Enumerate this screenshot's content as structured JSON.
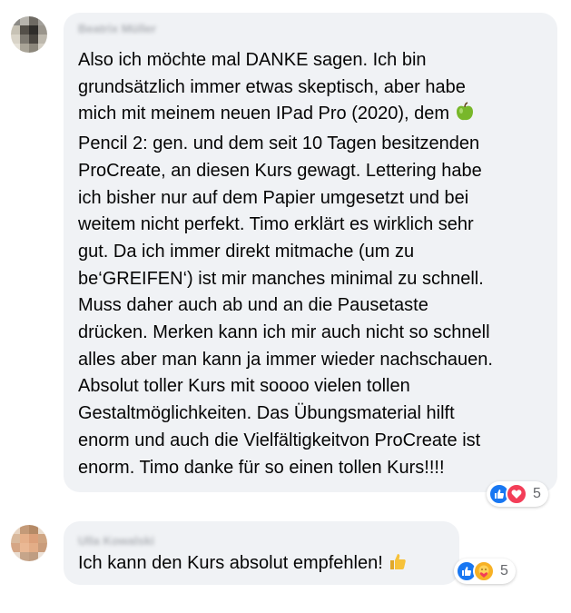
{
  "comments": [
    {
      "author": "Beatrix Müller",
      "text": "Also ich möchte mal DANKE sagen. Ich bin\ngrundsätzlich immer etwas skeptisch, aber habe\nmich mit meinem neuen IPad Pro (2020), dem",
      "text_after_emoji": "\nPencil 2: gen. und dem seit 10 Tagen besitzenden\nProCreate, an diesen Kurs gewagt. Lettering habe\nich bisher nur auf dem Papier umgesetzt und bei\nweitem nicht perfekt. Timo erklärt es wirklich sehr\ngut. Da ich immer direkt mitmache (um zu\nbe‘GREIFEN‘) ist mir manches minimal zu schnell.\nMuss daher auch ab und an die Pausetaste\ndrücken. Merken kann ich mir auch nicht so schnell\nalles aber man kann ja immer wieder nachschauen.\nAbsolut toller Kurs mit soooo vielen tollen\nGestaltmöglichkeiten. Das Übungsmaterial hilft\nenorm und auch die Vielfältigkeitvon ProCreate ist\nenorm. Timo danke für so einen tollen Kurs!!!!",
      "inline_emoji": "green-apple-icon",
      "reactions": [
        "like-icon",
        "love-icon"
      ],
      "reaction_count": "5"
    },
    {
      "author": "Ulla Kowalski",
      "text": "Ich kann den Kurs absolut empfehlen!",
      "inline_emoji": "thumbs-up-emoji-icon",
      "reactions": [
        "like-icon",
        "care-icon"
      ],
      "reaction_count": "5"
    }
  ],
  "colors": {
    "bubble": "#f0f2f5",
    "like": "#1877f2",
    "love": "#f33e58",
    "care": "#f7b125",
    "text": "#050505",
    "meta": "#65676b"
  }
}
